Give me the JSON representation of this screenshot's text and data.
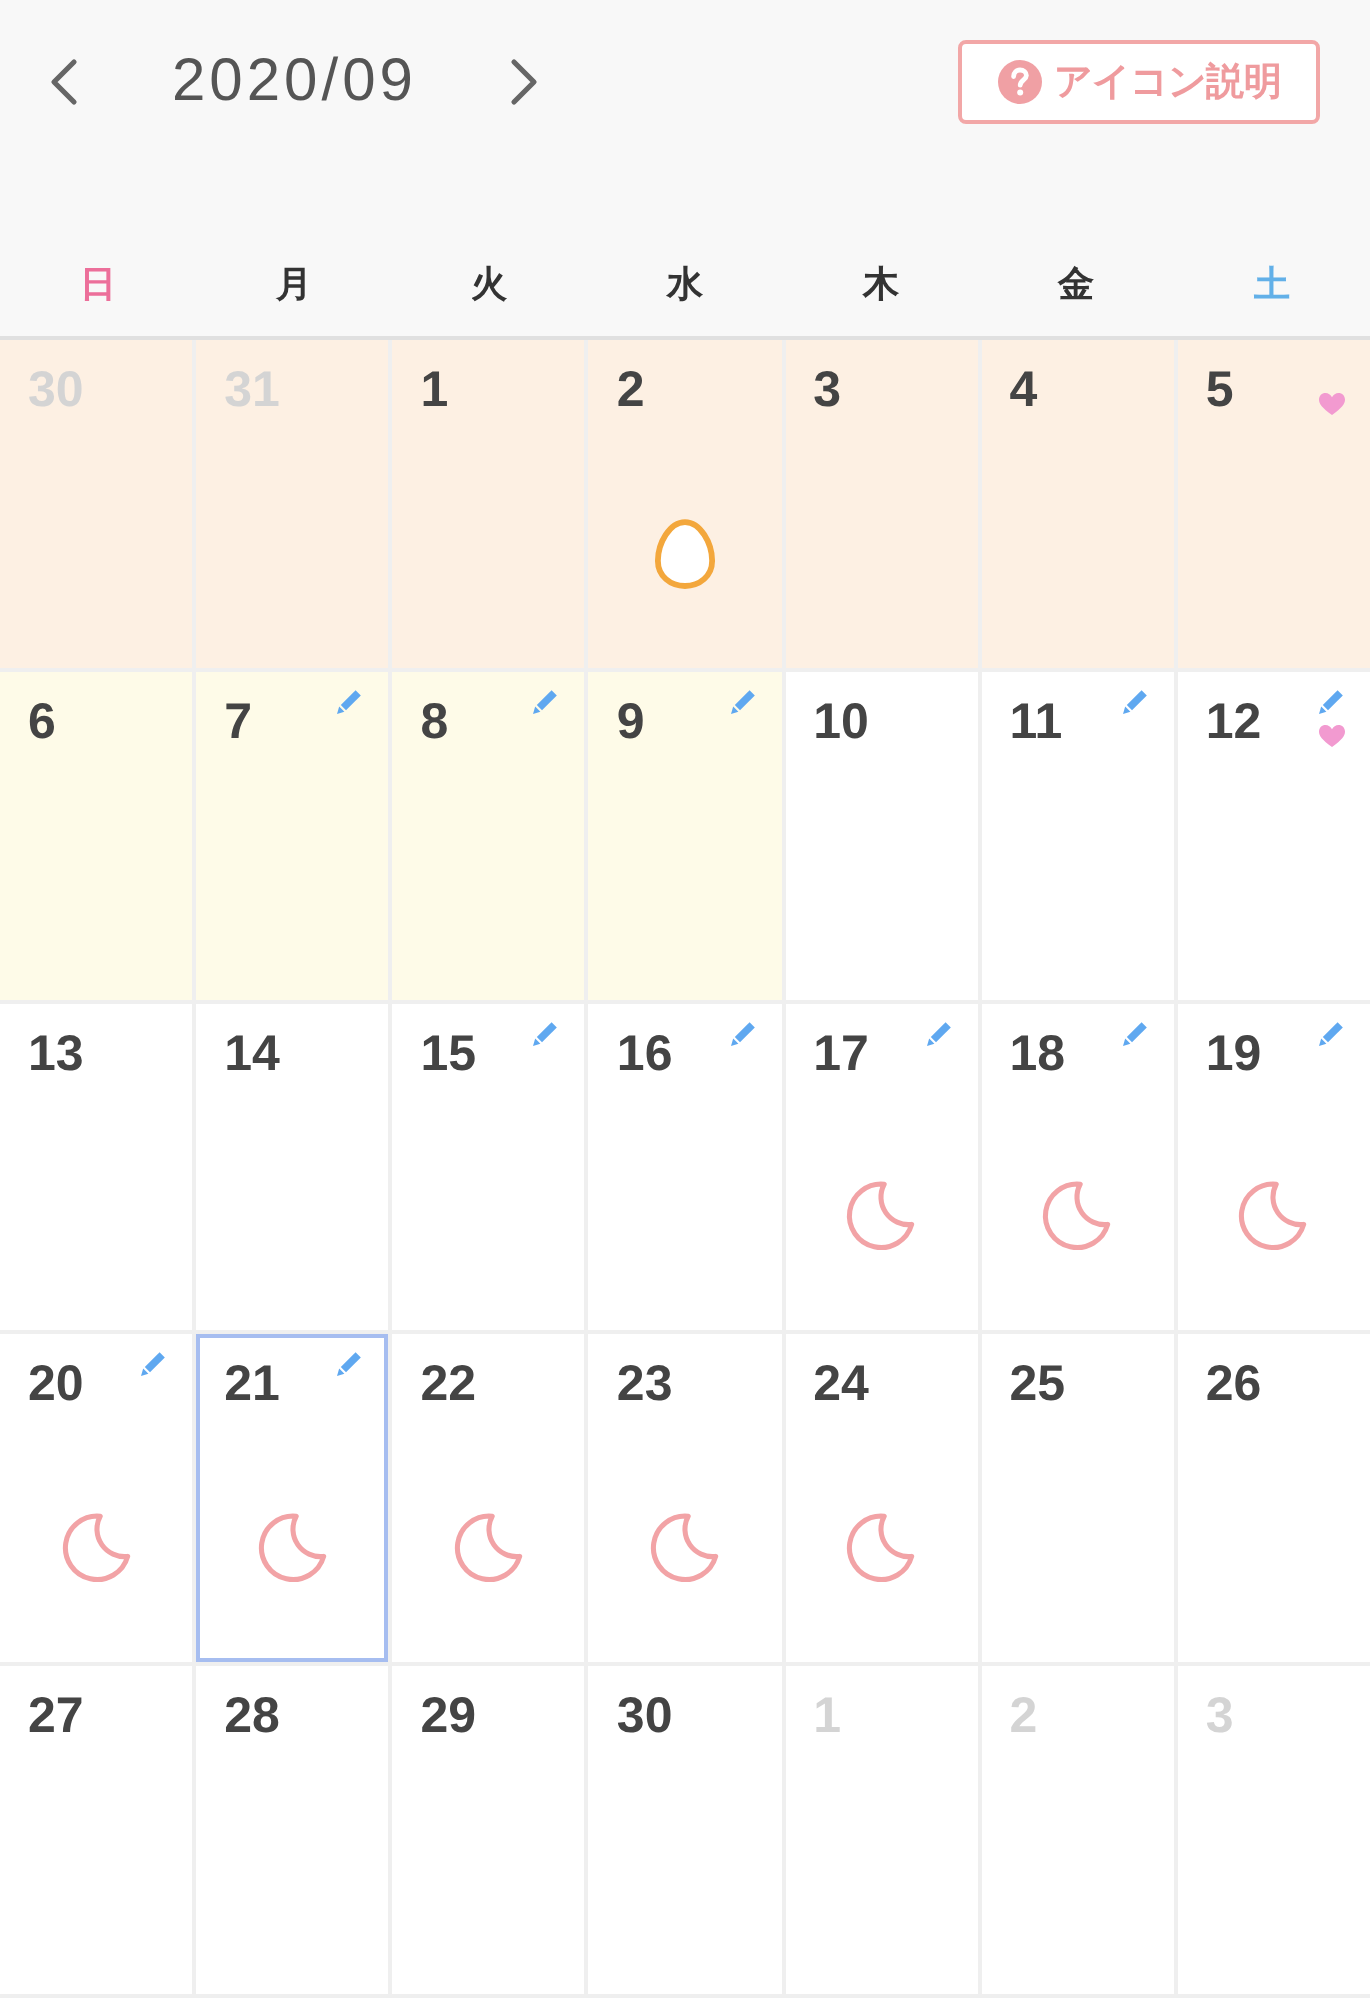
{
  "header": {
    "title": "2020/09",
    "help_button": {
      "label": "アイコン説明"
    }
  },
  "weekdays": [
    {
      "label": "日",
      "color": "#ec6f9a"
    },
    {
      "label": "月",
      "color": "#333333"
    },
    {
      "label": "火",
      "color": "#333333"
    },
    {
      "label": "水",
      "color": "#333333"
    },
    {
      "label": "木",
      "color": "#333333"
    },
    {
      "label": "金",
      "color": "#333333"
    },
    {
      "label": "土",
      "color": "#62b0e8"
    }
  ],
  "weeks": [
    {
      "days": [
        {
          "date": "30",
          "muted": true,
          "selected": false,
          "pencil": false,
          "heart": false,
          "color": "#fdf0e3"
        },
        {
          "date": "31",
          "muted": true,
          "selected": false,
          "pencil": false,
          "heart": false,
          "color": "#fdf0e3"
        },
        {
          "date": "1",
          "muted": false,
          "selected": false,
          "pencil": false,
          "heart": false,
          "color": "#fdf0e3"
        },
        {
          "date": "2",
          "muted": false,
          "selected": false,
          "pencil": false,
          "heart": false,
          "color": "#fdf0e3",
          "symbol": {
            "kind": "egg"
          }
        },
        {
          "date": "3",
          "muted": false,
          "selected": false,
          "pencil": false,
          "heart": false,
          "color": "#fdf0e3"
        },
        {
          "date": "4",
          "muted": false,
          "selected": false,
          "pencil": false,
          "heart": false,
          "color": "#fdf0e3"
        },
        {
          "date": "5",
          "muted": false,
          "selected": false,
          "pencil": false,
          "heart": true,
          "color": "#fdf0e3"
        }
      ]
    },
    {
      "days": [
        {
          "date": "6",
          "muted": false,
          "selected": false,
          "pencil": false,
          "heart": false,
          "color": "#fefbe8"
        },
        {
          "date": "7",
          "muted": false,
          "selected": false,
          "pencil": true,
          "heart": false,
          "color": "#fefbe8"
        },
        {
          "date": "8",
          "muted": false,
          "selected": false,
          "pencil": true,
          "heart": false,
          "color": "#fefbe8"
        },
        {
          "date": "9",
          "muted": false,
          "selected": false,
          "pencil": true,
          "heart": false,
          "color": "#fefbe8"
        },
        {
          "date": "10",
          "muted": false,
          "selected": false,
          "pencil": false,
          "heart": false
        },
        {
          "date": "11",
          "muted": false,
          "selected": false,
          "pencil": true,
          "heart": false
        },
        {
          "date": "12",
          "muted": false,
          "selected": false,
          "pencil": true,
          "heart": true
        }
      ]
    },
    {
      "days": [
        {
          "date": "13",
          "muted": false,
          "selected": false,
          "pencil": false,
          "heart": false
        },
        {
          "date": "14",
          "muted": false,
          "selected": false,
          "pencil": false,
          "heart": false
        },
        {
          "date": "15",
          "muted": false,
          "selected": false,
          "pencil": true,
          "heart": false
        },
        {
          "date": "16",
          "muted": false,
          "selected": false,
          "pencil": true,
          "heart": false
        },
        {
          "date": "17",
          "muted": false,
          "selected": false,
          "pencil": true,
          "heart": false,
          "symbol": {
            "kind": "moon"
          }
        },
        {
          "date": "18",
          "muted": false,
          "selected": false,
          "pencil": true,
          "heart": false,
          "symbol": {
            "kind": "moon"
          }
        },
        {
          "date": "19",
          "muted": false,
          "selected": false,
          "pencil": true,
          "heart": false,
          "symbol": {
            "kind": "moon"
          }
        }
      ]
    },
    {
      "days": [
        {
          "date": "20",
          "muted": false,
          "selected": false,
          "pencil": true,
          "heart": false,
          "symbol": {
            "kind": "moon"
          }
        },
        {
          "date": "21",
          "muted": false,
          "selected": true,
          "pencil": true,
          "heart": false,
          "symbol": {
            "kind": "moon"
          }
        },
        {
          "date": "22",
          "muted": false,
          "selected": false,
          "pencil": false,
          "heart": false,
          "symbol": {
            "kind": "moon"
          }
        },
        {
          "date": "23",
          "muted": false,
          "selected": false,
          "pencil": false,
          "heart": false,
          "symbol": {
            "kind": "moon"
          }
        },
        {
          "date": "24",
          "muted": false,
          "selected": false,
          "pencil": false,
          "heart": false,
          "symbol": {
            "kind": "moon"
          }
        },
        {
          "date": "25",
          "muted": false,
          "selected": false,
          "pencil": false,
          "heart": false
        },
        {
          "date": "26",
          "muted": false,
          "selected": false,
          "pencil": false,
          "heart": false
        }
      ]
    },
    {
      "days": [
        {
          "date": "27",
          "muted": false,
          "selected": false,
          "pencil": false,
          "heart": false
        },
        {
          "date": "28",
          "muted": false,
          "selected": false,
          "pencil": false,
          "heart": false
        },
        {
          "date": "29",
          "muted": false,
          "selected": false,
          "pencil": false,
          "heart": false
        },
        {
          "date": "30",
          "muted": false,
          "selected": false,
          "pencil": false,
          "heart": false
        },
        {
          "date": "1",
          "muted": true,
          "selected": false,
          "pencil": false,
          "heart": false
        },
        {
          "date": "2",
          "muted": true,
          "selected": false,
          "pencil": false,
          "heart": false
        },
        {
          "date": "3",
          "muted": true,
          "selected": false,
          "pencil": false,
          "heart": false
        }
      ]
    }
  ]
}
